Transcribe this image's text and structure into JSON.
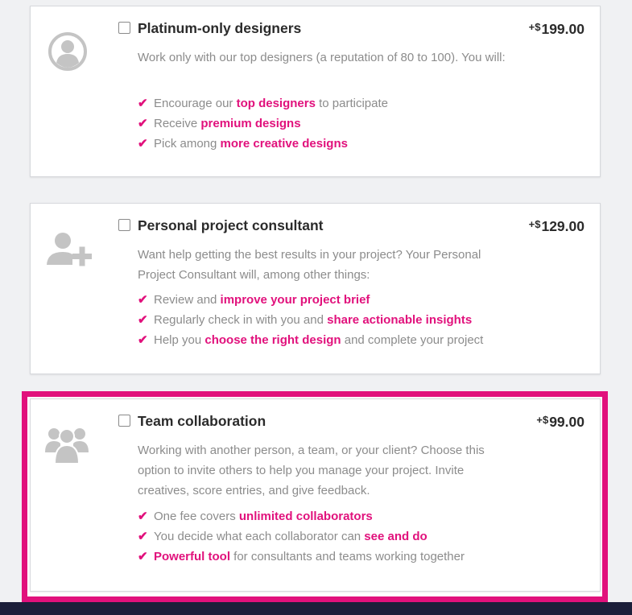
{
  "addons": [
    {
      "title": "Platinum-only designers",
      "price_sign": "+$",
      "price_amount": "199.00",
      "icon": "avatar-icon",
      "description": "Work only with our top designers (a reputation of 80 to 100). You will:",
      "features": [
        {
          "pre": "Encourage our ",
          "hl": "top designers",
          "post": " to participate"
        },
        {
          "pre": "Receive ",
          "hl": "premium designs",
          "post": ""
        },
        {
          "pre": "Pick among ",
          "hl": "more creative designs",
          "post": ""
        }
      ]
    },
    {
      "title": "Personal project consultant",
      "price_sign": "+$",
      "price_amount": "129.00",
      "icon": "add-user-icon",
      "description": "Want help getting the best results in your project? Your Personal Project Consultant will, among other things:",
      "features": [
        {
          "pre": "Review and ",
          "hl": "improve your project brief",
          "post": ""
        },
        {
          "pre": "Regularly check in with you and ",
          "hl": "share actionable insights",
          "post": ""
        },
        {
          "pre": "Help you ",
          "hl": "choose the right design",
          "post": " and complete your project"
        }
      ]
    },
    {
      "title": "Team collaboration",
      "price_sign": "+$",
      "price_amount": "99.00",
      "icon": "team-icon",
      "description": "Working with another person, a team, or your client? Choose this option to invite others to help you manage your project. Invite creatives, score entries, and give feedback.",
      "features": [
        {
          "pre": "One fee covers ",
          "hl": "unlimited collaborators",
          "post": ""
        },
        {
          "pre": "You decide what each collaborator can ",
          "hl": "see and do",
          "post": ""
        },
        {
          "pre": "",
          "hl": "Powerful tool",
          "post": " for consultants and teams working together"
        }
      ]
    }
  ],
  "check_glyph": "✔",
  "colors": {
    "accent": "#e1117c",
    "icon_gray": "#c4c4c4",
    "text_gray": "#8c8c8c"
  }
}
